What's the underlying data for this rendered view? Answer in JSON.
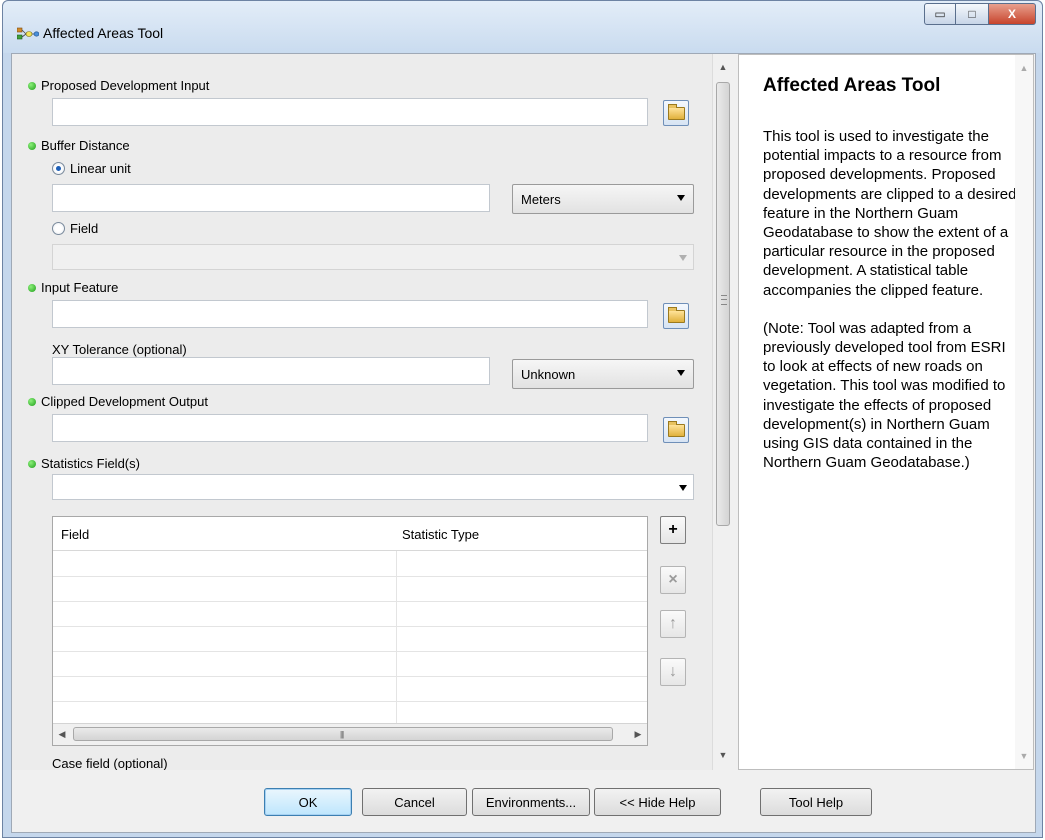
{
  "window": {
    "title": "Affected Areas Tool",
    "min_glyph": "▭",
    "max_glyph": "□",
    "close_glyph": "X"
  },
  "form": {
    "proposed_dev_input": {
      "label": "Proposed Development Input",
      "value": ""
    },
    "buffer_distance": {
      "label": "Buffer Distance",
      "linear_unit_label": "Linear unit",
      "linear_value": "",
      "unit_selected": "Meters",
      "field_label": "Field",
      "field_value": ""
    },
    "input_feature": {
      "label": "Input Feature",
      "value": ""
    },
    "xy_tolerance": {
      "label": "XY Tolerance (optional)",
      "value": "",
      "unit_selected": "Unknown"
    },
    "clipped_output": {
      "label": "Clipped Development Output",
      "value": ""
    },
    "statistics_fields": {
      "label": "Statistics Field(s)",
      "value": "",
      "columns": [
        "Field",
        "Statistic Type"
      ],
      "rows": []
    },
    "case_field": {
      "label": "Case field (optional)"
    },
    "grid_buttons": {
      "add": "+",
      "remove": "×",
      "up": "↑",
      "down": "↓"
    }
  },
  "help": {
    "title": "Affected Areas Tool",
    "paragraphs": [
      "This tool is used to investigate the potential impacts to a resource from proposed developments. Proposed developments are clipped to a desired feature in the Northern Guam Geodatabase to show the extent of a particular resource in the proposed development. A statistical table accompanies the clipped feature.",
      "(Note: Tool was adapted from a previously developed tool from ESRI to look at effects of new roads on vegetation. This tool was modified to investigate the effects of proposed development(s) in Northern Guam using GIS data contained in the Northern Guam Geodatabase.)"
    ]
  },
  "buttons": {
    "ok": "OK",
    "cancel": "Cancel",
    "environments": "Environments...",
    "hide_help": "<< Hide Help",
    "tool_help": "Tool Help"
  },
  "icons": {
    "app": "model-tool-icon",
    "browse": "open-folder-icon",
    "required": "green-dot-icon"
  },
  "colors": {
    "required_dot": "#1e9e1a",
    "title_bar": "#c9dbef",
    "close_button": "#c7442c"
  }
}
